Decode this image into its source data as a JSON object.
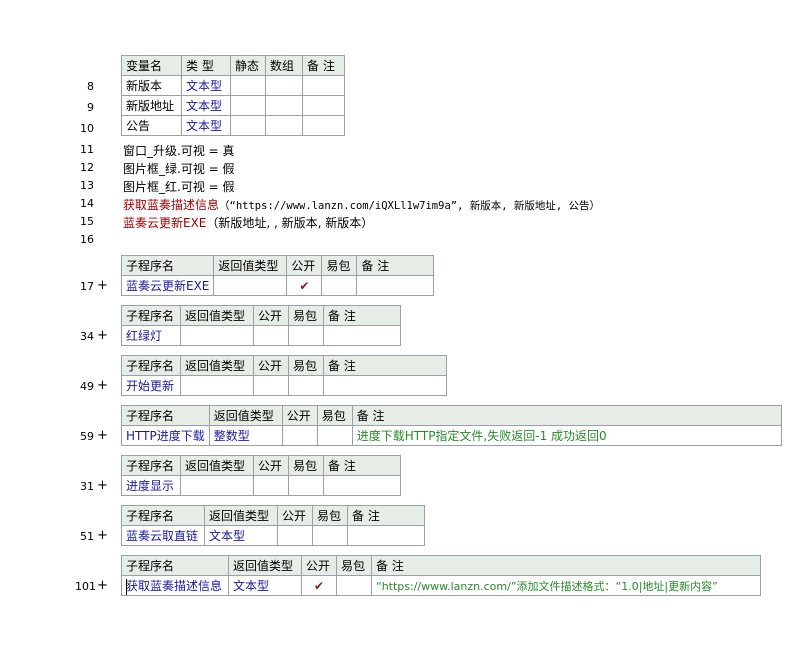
{
  "vars": {
    "headers": [
      "变量名",
      "类 型",
      "静态",
      "数组",
      "备 注"
    ],
    "rows": [
      {
        "line": "8",
        "name": "新版本",
        "type": "文本型"
      },
      {
        "line": "9",
        "name": "新版地址",
        "type": "文本型"
      },
      {
        "line": "10",
        "name": "公告",
        "type": "文本型"
      }
    ]
  },
  "lines": [
    {
      "num": "11",
      "text": "窗口_升级.可视 = 真"
    },
    {
      "num": "12",
      "text": "图片框_绿.可视 = 假"
    },
    {
      "num": "13",
      "text": "图片框_红.可视 = 假"
    },
    {
      "num": "14",
      "func": "获取蓝奏描述信息",
      "args": "（“https://www.lanzn.com/iQXLl1w7im9a”, 新版本, 新版地址, 公告）"
    },
    {
      "num": "15",
      "func": "蓝奏云更新EXE",
      "args": "（新版地址, , 新版本, 新版本）"
    },
    {
      "num": "16",
      "text": ""
    }
  ],
  "sub_headers": [
    "子程序名",
    "返回值类型",
    "公开",
    "易包",
    "备 注"
  ],
  "subs": [
    {
      "line": "17",
      "name": "蓝奏云更新EXE",
      "ret": "",
      "public": "✔",
      "note": ""
    },
    {
      "line": "34",
      "name": "红绿灯",
      "ret": "",
      "public": "",
      "note": ""
    },
    {
      "line": "49",
      "name": "开始更新",
      "ret": "",
      "public": "",
      "note": ""
    },
    {
      "line": "59",
      "name": "HTTP进度下载",
      "ret": "整数型",
      "public": "",
      "note": "进度下载HTTP指定文件,失败返回-1    成功返回0"
    },
    {
      "line": "31",
      "name": "进度显示",
      "ret": "",
      "public": "",
      "note": ""
    },
    {
      "line": "51",
      "name": "蓝奏云取直链",
      "ret": "文本型",
      "public": "",
      "note": ""
    },
    {
      "line": "101",
      "name": "获取蓝奏描述信息",
      "ret": "文本型",
      "public": "✔",
      "note": "“https://www.lanzn.com/”添加文件描述格式：“1.0|地址|更新内容”"
    }
  ],
  "expand_symbol": "+"
}
